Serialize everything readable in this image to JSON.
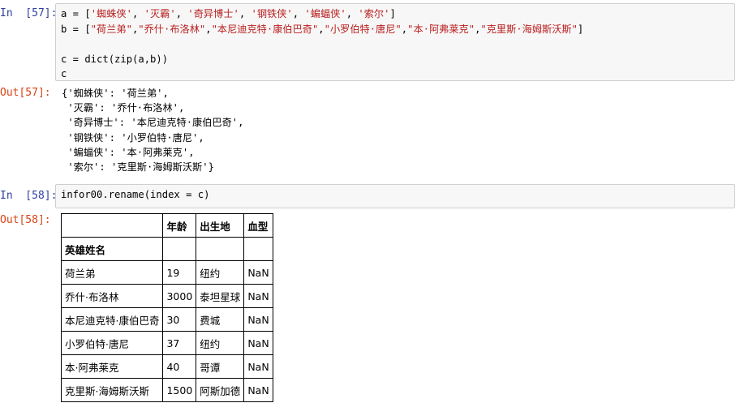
{
  "cells": [
    {
      "in_prompt": "In  [57]:",
      "code_lines": [
        [
          {
            "t": "a = [",
            "c": ""
          },
          {
            "t": "'蜘蛛侠'",
            "c": "str"
          },
          {
            "t": ", ",
            "c": ""
          },
          {
            "t": "'灭霸'",
            "c": "str"
          },
          {
            "t": ", ",
            "c": ""
          },
          {
            "t": "'奇异博士'",
            "c": "str"
          },
          {
            "t": ", ",
            "c": ""
          },
          {
            "t": "'钢铁侠'",
            "c": "str"
          },
          {
            "t": ", ",
            "c": ""
          },
          {
            "t": "'蝙蝠侠'",
            "c": "str"
          },
          {
            "t": ", ",
            "c": ""
          },
          {
            "t": "'索尔'",
            "c": "str"
          },
          {
            "t": "]",
            "c": ""
          }
        ],
        [
          {
            "t": "b = [",
            "c": ""
          },
          {
            "t": "\"荷兰弟\"",
            "c": "str"
          },
          {
            "t": ",",
            "c": ""
          },
          {
            "t": "\"乔什·布洛林\"",
            "c": "str"
          },
          {
            "t": ",",
            "c": ""
          },
          {
            "t": "\"本尼迪克特·康伯巴奇\"",
            "c": "str"
          },
          {
            "t": ",",
            "c": ""
          },
          {
            "t": "\"小罗伯特·唐尼\"",
            "c": "str"
          },
          {
            "t": ",",
            "c": ""
          },
          {
            "t": "\"本·阿弗莱克\"",
            "c": "str"
          },
          {
            "t": ",",
            "c": ""
          },
          {
            "t": "\"克里斯·海姆斯沃斯\"",
            "c": "str"
          },
          {
            "t": "]",
            "c": ""
          }
        ],
        [],
        [
          {
            "t": "c = dict(zip(a,b))",
            "c": ""
          }
        ],
        [
          {
            "t": "c",
            "c": ""
          }
        ]
      ],
      "out_prompt": "Out[57]:",
      "output_lines": [
        "{'蜘蛛侠': '荷兰弟',",
        " '灭霸': '乔什·布洛林',",
        " '奇异博士': '本尼迪克特·康伯巴奇',",
        " '钢铁侠': '小罗伯特·唐尼',",
        " '蝙蝠侠': '本·阿弗莱克',",
        " '索尔': '克里斯·海姆斯沃斯'}"
      ]
    },
    {
      "in_prompt": "In  [58]:",
      "code_lines": [
        [
          {
            "t": "infor00.rename(index = c)",
            "c": ""
          }
        ]
      ],
      "out_prompt": "Out[58]:"
    }
  ],
  "dataframe": {
    "columns": [
      "年龄",
      "出生地",
      "血型"
    ],
    "index_name": "英雄姓名",
    "rows": [
      {
        "index": "荷兰弟",
        "values": [
          "19",
          "纽约",
          "NaN"
        ]
      },
      {
        "index": "乔什·布洛林",
        "values": [
          "3000",
          "泰坦星球",
          "NaN"
        ]
      },
      {
        "index": "本尼迪克特·康伯巴奇",
        "values": [
          "30",
          "费城",
          "NaN"
        ]
      },
      {
        "index": "小罗伯特·唐尼",
        "values": [
          "37",
          "纽约",
          "NaN"
        ]
      },
      {
        "index": "本·阿弗莱克",
        "values": [
          "40",
          "哥谭",
          "NaN"
        ]
      },
      {
        "index": "克里斯·海姆斯沃斯",
        "values": [
          "1500",
          "阿斯加德",
          "NaN"
        ]
      }
    ]
  }
}
